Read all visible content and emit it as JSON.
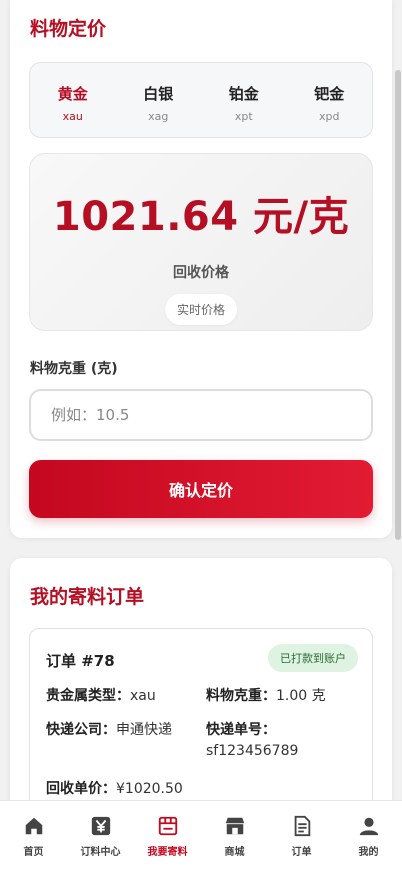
{
  "pricing": {
    "title": "料物定价",
    "metals": [
      {
        "name": "黄金",
        "code": "xau",
        "active": true
      },
      {
        "name": "白银",
        "code": "xag",
        "active": false
      },
      {
        "name": "铂金",
        "code": "xpt",
        "active": false
      },
      {
        "name": "钯金",
        "code": "xpd",
        "active": false
      }
    ],
    "price_value": "1021.64 元/克",
    "price_label": "回收价格",
    "price_badge": "实时价格",
    "weight_label": "料物克重 (克)",
    "weight_placeholder": "例如：10.5",
    "confirm_label": "确认定价"
  },
  "orders": {
    "title": "我的寄料订单",
    "order_no": "订单 #78",
    "status": "已打款到账户",
    "metal_type_label": "贵金属类型：",
    "metal_type_value": "xau",
    "weight_label": "料物克重：",
    "weight_value": "1.00 克",
    "courier_label": "快递公司：",
    "courier_value": "申通快递",
    "tracking_label": "快递单号：",
    "tracking_value": "sf123456789",
    "unit_price_label": "回收单价：",
    "unit_price_value": "¥1020.50"
  },
  "nav": {
    "items": [
      {
        "label": "首页",
        "icon": "home-icon"
      },
      {
        "label": "订料中心",
        "icon": "yen-icon"
      },
      {
        "label": "我要寄料",
        "icon": "package-icon",
        "active": true
      },
      {
        "label": "商城",
        "icon": "store-icon"
      },
      {
        "label": "订单",
        "icon": "document-icon"
      },
      {
        "label": "我的",
        "icon": "user-icon"
      }
    ]
  },
  "colors": {
    "accent": "#c4081f",
    "status_bg": "#dff3e2",
    "status_text": "#2b6b34"
  }
}
